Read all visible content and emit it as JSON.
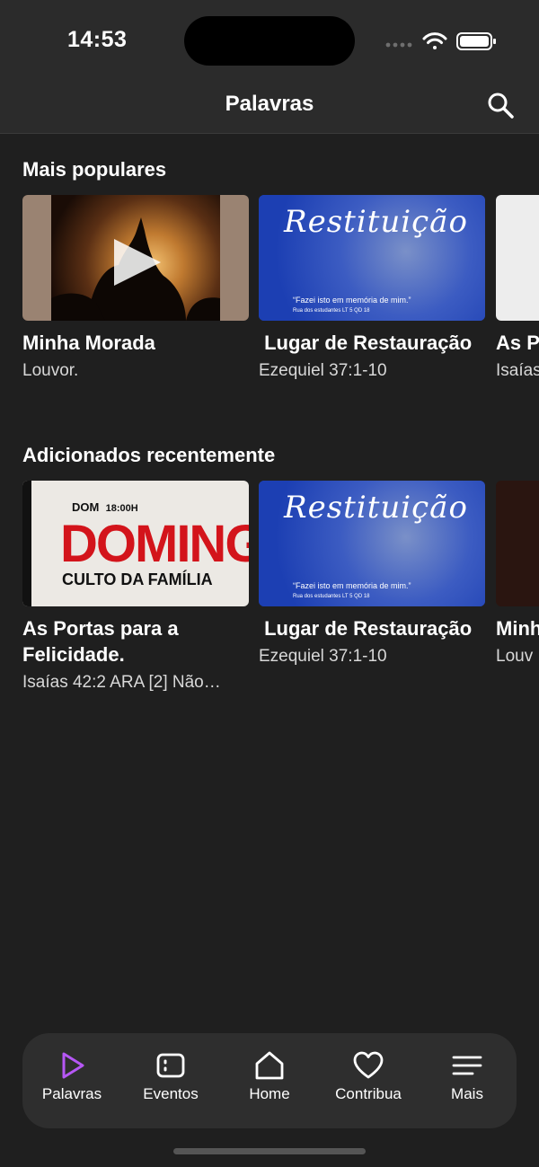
{
  "status_bar": {
    "time": "14:53"
  },
  "header": {
    "title": "Palavras",
    "search_icon": "search-icon"
  },
  "sections": [
    {
      "title": "Mais populares",
      "cards": [
        {
          "title": "Minha Morada",
          "subtitle": "Louvor.",
          "thumb": "concert-play"
        },
        {
          "title": " Lugar de Restauração",
          "subtitle": "Ezequiel 37:1-10",
          "thumb": "restituicao",
          "thumb_text": {
            "script": "Restituição",
            "quote": "“Fazei isto em memória de mim.”",
            "address": "Rua dos estudantes LT 5 QD 18"
          }
        },
        {
          "title": "As P",
          "subtitle": "Isaías",
          "thumb": "partial"
        }
      ]
    },
    {
      "title": "Adicionados recentemente",
      "cards": [
        {
          "title": "As Portas para a Felicidade.",
          "subtitle": "Isaías 42:2 ARA [2] Não…",
          "thumb": "domingo",
          "thumb_text": {
            "day": "DOM",
            "time": "18:00H",
            "big": "DOMINGO",
            "event": "CULTO DA FAMÍLIA"
          }
        },
        {
          "title": " Lugar de Restauração",
          "subtitle": "Ezequiel 37:1-10",
          "thumb": "restituicao",
          "thumb_text": {
            "script": "Restituição",
            "quote": "“Fazei isto em memória de mim.”",
            "address": "Rua dos estudantes LT 5 QD 18"
          }
        },
        {
          "title": "Minh",
          "subtitle": "Louv",
          "thumb": "partial-dark"
        }
      ]
    }
  ],
  "tabs": [
    {
      "label": "Palavras",
      "icon": "play-icon",
      "active": true
    },
    {
      "label": "Eventos",
      "icon": "calendar-icon",
      "active": false
    },
    {
      "label": "Home",
      "icon": "home-icon",
      "active": false
    },
    {
      "label": "Contribua",
      "icon": "heart-icon",
      "active": false
    },
    {
      "label": "Mais",
      "icon": "menu-icon",
      "active": false
    }
  ],
  "colors": {
    "background": "#1f1f1f",
    "header": "#2b2b2b",
    "accent": "#b657f5",
    "tabbar": "#2e2e2e"
  }
}
